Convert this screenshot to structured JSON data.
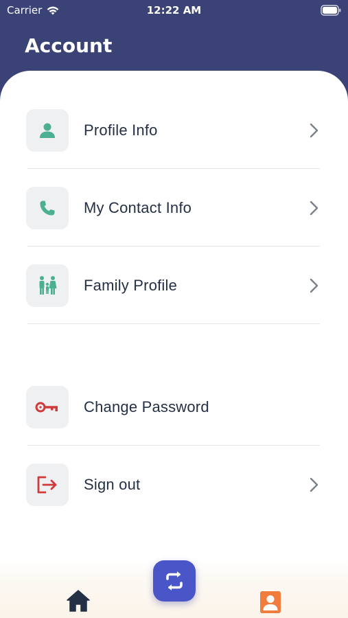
{
  "status_bar": {
    "carrier": "Carrier",
    "time": "12:22 AM"
  },
  "header": {
    "title": "Account"
  },
  "menu": {
    "profile_info": "Profile Info",
    "contact_info": "My Contact Info",
    "family_profile": "Family Profile",
    "change_password": "Change Password",
    "sign_out": "Sign out"
  },
  "colors": {
    "header_bg": "#3a4276",
    "icon_green": "#4caf92",
    "icon_red": "#d03a3a",
    "fab_bg": "#4a56c8",
    "nav_home": "#243045",
    "nav_profile": "#f07c3e"
  },
  "icons": [
    "wifi-icon",
    "battery-icon",
    "person-icon",
    "phone-icon",
    "family-icon",
    "key-icon",
    "sign-out-icon",
    "chevron-right-icon",
    "home-icon",
    "sync-icon",
    "profile-contact-icon"
  ]
}
